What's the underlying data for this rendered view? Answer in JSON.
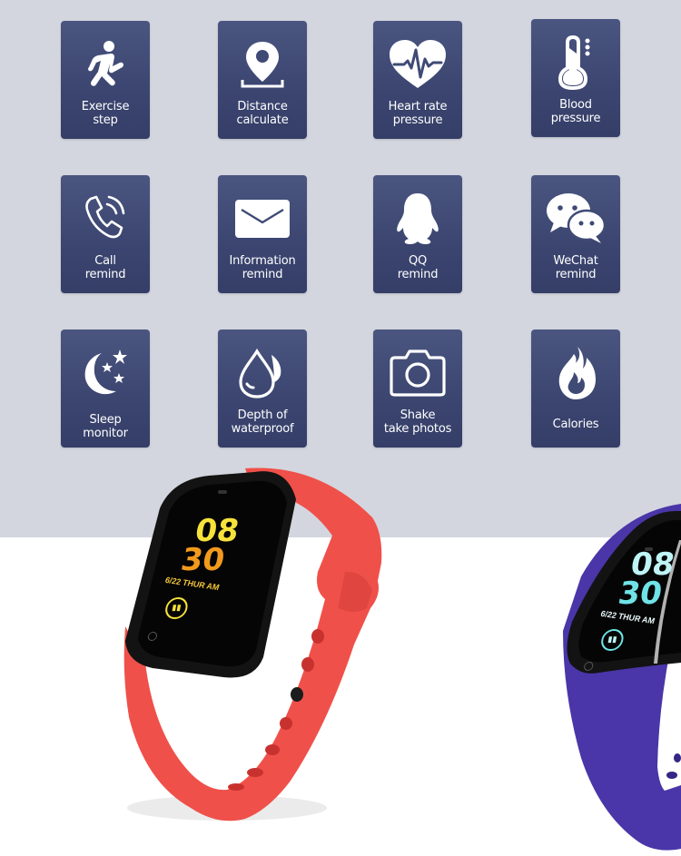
{
  "features": [
    {
      "icon": "running-person-icon",
      "lines": [
        "Exercise",
        "step"
      ]
    },
    {
      "icon": "location-pin-icon",
      "lines": [
        "Distance",
        "calculate"
      ]
    },
    {
      "icon": "heart-pulse-icon",
      "lines": [
        "Heart rate",
        "pressure"
      ]
    },
    {
      "icon": "thermometer-icon",
      "lines": [
        "Blood",
        "pressure"
      ]
    },
    {
      "icon": "phone-ringing-icon",
      "lines": [
        "Call",
        "remind"
      ]
    },
    {
      "icon": "envelope-icon",
      "lines": [
        "Information",
        "remind"
      ]
    },
    {
      "icon": "qq-penguin-icon",
      "lines": [
        "QQ",
        "remind"
      ]
    },
    {
      "icon": "wechat-icon",
      "lines": [
        "WeChat",
        "remind"
      ]
    },
    {
      "icon": "moon-stars-icon",
      "lines": [
        "Sleep",
        "monitor"
      ]
    },
    {
      "icon": "water-drop-icon",
      "lines": [
        "Depth of",
        "waterproof"
      ]
    },
    {
      "icon": "camera-icon",
      "lines": [
        "Shake",
        "take photos"
      ]
    },
    {
      "icon": "flame-icon",
      "lines": [
        "Calories"
      ]
    }
  ],
  "watches": [
    {
      "color_name": "red",
      "band_color": "#f0504a",
      "hour": "08",
      "minute": "30",
      "date": "6/22 THUR AM",
      "hour_color": "#f7e23a",
      "minute_color": "#f19a1c",
      "date_color": "#f3c53a"
    },
    {
      "color_name": "purple",
      "band_color": "#4a36a8",
      "hour": "08",
      "minute": "30",
      "date": "6/22 THUR AM",
      "hour_color": "#bff4f6",
      "minute_color": "#6fe3e6",
      "date_color": "#e6f6f8"
    }
  ],
  "colors": {
    "tile_bg": "#3f4a75",
    "page_top": "#d3d6de",
    "page_bottom": "#ffffff"
  }
}
